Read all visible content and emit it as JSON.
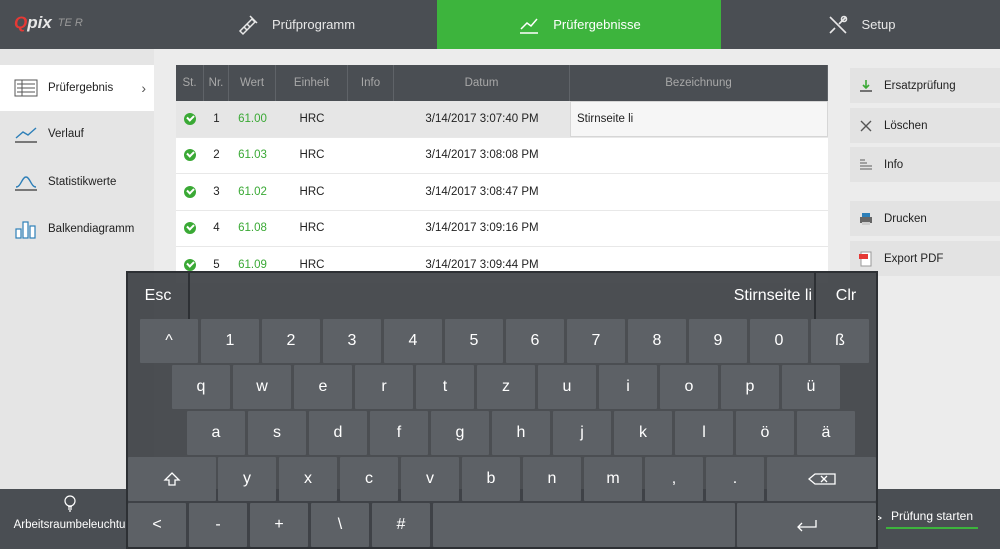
{
  "app": {
    "logo_main_prefix": "Q",
    "logo_main_suffix": "pix",
    "logo_sub": "TE R"
  },
  "tabs": [
    {
      "label": "Prüfprogramm",
      "icon": "program-icon",
      "active": false
    },
    {
      "label": "Prüfergebnisse",
      "icon": "chart-line-icon",
      "active": true
    },
    {
      "label": "Setup",
      "icon": "tools-icon",
      "active": false
    }
  ],
  "sidebar": {
    "items": [
      {
        "label": "Prüfergebnis",
        "icon": "list-icon",
        "active": true,
        "chevron": "›"
      },
      {
        "label": "Verlauf",
        "icon": "trend-icon",
        "active": false
      },
      {
        "label": "Statistikwerte",
        "icon": "bell-curve-icon",
        "active": false
      },
      {
        "label": "Balkendiagramm",
        "icon": "bar-chart-icon",
        "active": false
      }
    ]
  },
  "table": {
    "headers": [
      "St.",
      "Nr.",
      "Wert",
      "Einheit",
      "Info",
      "Datum",
      "Bezeichnung"
    ],
    "rows": [
      {
        "nr": "1",
        "wert": "61.00",
        "einheit": "HRC",
        "info": "",
        "datum": "3/14/2017 3:07:40 PM",
        "bezeichnung": "Stirnseite li",
        "selected": true
      },
      {
        "nr": "2",
        "wert": "61.03",
        "einheit": "HRC",
        "info": "",
        "datum": "3/14/2017 3:08:08 PM",
        "bezeichnung": ""
      },
      {
        "nr": "3",
        "wert": "61.02",
        "einheit": "HRC",
        "info": "",
        "datum": "3/14/2017 3:08:47 PM",
        "bezeichnung": ""
      },
      {
        "nr": "4",
        "wert": "61.08",
        "einheit": "HRC",
        "info": "",
        "datum": "3/14/2017 3:09:16 PM",
        "bezeichnung": ""
      },
      {
        "nr": "5",
        "wert": "61.09",
        "einheit": "HRC",
        "info": "",
        "datum": "3/14/2017 3:09:44 PM",
        "bezeichnung": ""
      }
    ]
  },
  "actions": {
    "replacement": "Ersatzprüfung",
    "delete": "Löschen",
    "info": "Info",
    "print": "Drucken",
    "export_pdf": "Export PDF"
  },
  "bottom": {
    "lamp_label": "Arbeitsraumbeleuchtu",
    "start_label": "Prüfung starten",
    "start_arrow": ">"
  },
  "keyboard": {
    "esc": "Esc",
    "display": "Stirnseite li",
    "clr": "Clr",
    "row1": [
      "^",
      "1",
      "2",
      "3",
      "4",
      "5",
      "6",
      "7",
      "8",
      "9",
      "0",
      "ß"
    ],
    "row2": [
      "q",
      "w",
      "e",
      "r",
      "t",
      "z",
      "u",
      "i",
      "o",
      "p",
      "ü"
    ],
    "row3": [
      "a",
      "s",
      "d",
      "f",
      "g",
      "h",
      "j",
      "k",
      "l",
      "ö",
      "ä"
    ],
    "row4": [
      "y",
      "x",
      "c",
      "v",
      "b",
      "n",
      "m",
      ",",
      "."
    ],
    "row5": [
      "<",
      "-",
      "+",
      "\\",
      "#"
    ]
  },
  "colors": {
    "accent": "#3db43d",
    "topbar": "#4a4e53",
    "value_green": "#3aa935"
  }
}
